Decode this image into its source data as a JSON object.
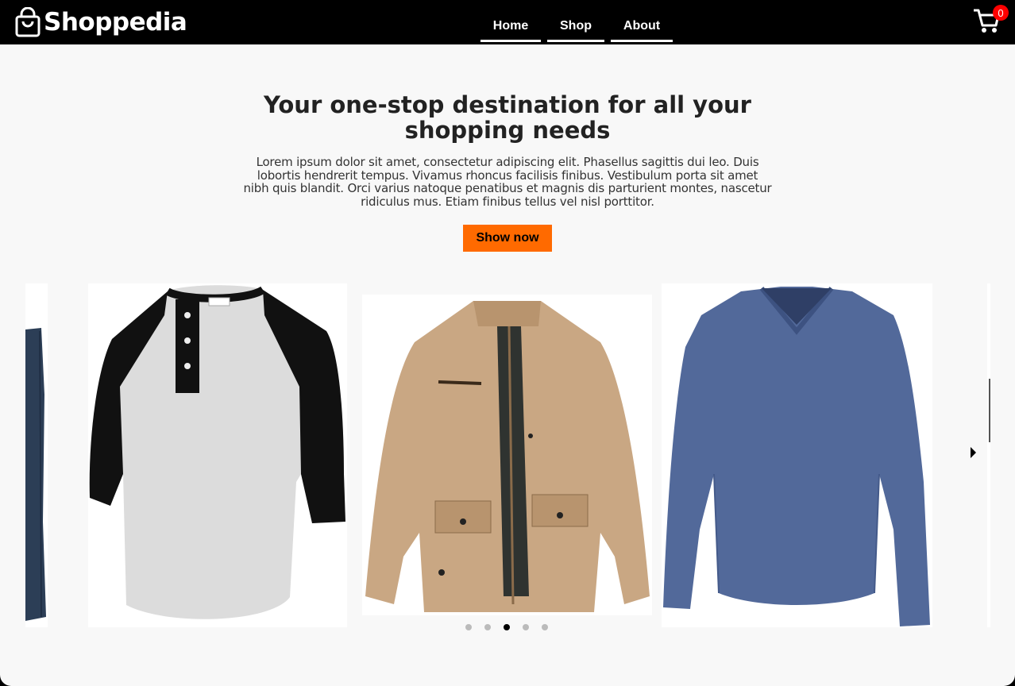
{
  "header": {
    "brand": "Shoppedia",
    "nav": [
      {
        "label": "Home"
      },
      {
        "label": "Shop"
      },
      {
        "label": "About"
      }
    ],
    "cart_count": "0"
  },
  "hero": {
    "title": "Your one-stop destination for all your shopping needs",
    "body": "Lorem ipsum dolor sit amet, consectetur adipiscing elit. Phasellus sagittis dui leo. Duis lobortis hendrerit tempus. Vivamus rhoncus facilisis finibus. Vestibulum porta sit amet nibh quis blandit. Orci varius natoque penatibus et magnis dis parturient montes, nascetur ridiculus mus. Etiam finibus tellus vel nisl porttitor.",
    "cta_label": "Show now"
  },
  "carousel": {
    "items": [
      {
        "icon": "denim-garment-image"
      },
      {
        "icon": "raglan-henley-tshirt-image"
      },
      {
        "icon": "khaki-jacket-image"
      },
      {
        "icon": "blue-vneck-longsleeve-image"
      }
    ],
    "slide_count": 5,
    "active_slide": 3
  },
  "colors": {
    "accent": "#ff6a00",
    "badge": "#ff0000",
    "header_bg": "#000000",
    "page_bg": "#f8f8f8"
  }
}
